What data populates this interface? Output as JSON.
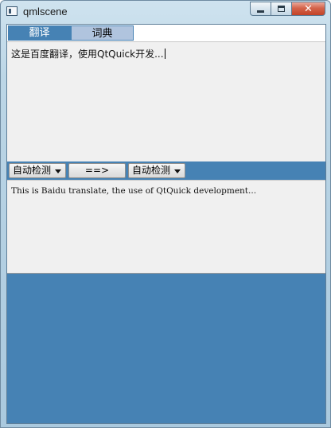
{
  "window": {
    "title": "qmlscene",
    "icon": "app-window-icon",
    "buttons": {
      "minimize": "",
      "maximize": "",
      "close": "✕"
    }
  },
  "tabs": [
    {
      "label": "翻译",
      "active": true
    },
    {
      "label": "词典",
      "active": false
    }
  ],
  "source": {
    "text": "这是百度翻译，使用QtQuick开发..."
  },
  "controls": {
    "from_lang": "自动检测",
    "swap_label": "==>",
    "to_lang": "自动检测"
  },
  "result": {
    "text": "This is Baidu translate, the use of QtQuick development..."
  },
  "colors": {
    "accent": "#4682b4",
    "tab_inactive": "#b0c4de",
    "text_area_bg": "#f0f0f0"
  }
}
